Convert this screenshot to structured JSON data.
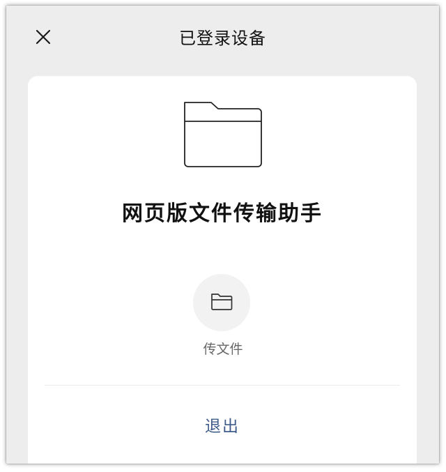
{
  "header": {
    "title": "已登录设备",
    "close_icon": "close-icon"
  },
  "device": {
    "icon": "folder-icon",
    "name": "网页版文件传输助手"
  },
  "actions": {
    "send_file": {
      "icon": "folder-icon",
      "label": "传文件"
    },
    "logout_label": "退出"
  },
  "colors": {
    "background": "#ededed",
    "card": "#ffffff",
    "logout_link": "#3e5c8a",
    "secondary_text": "#666666"
  }
}
